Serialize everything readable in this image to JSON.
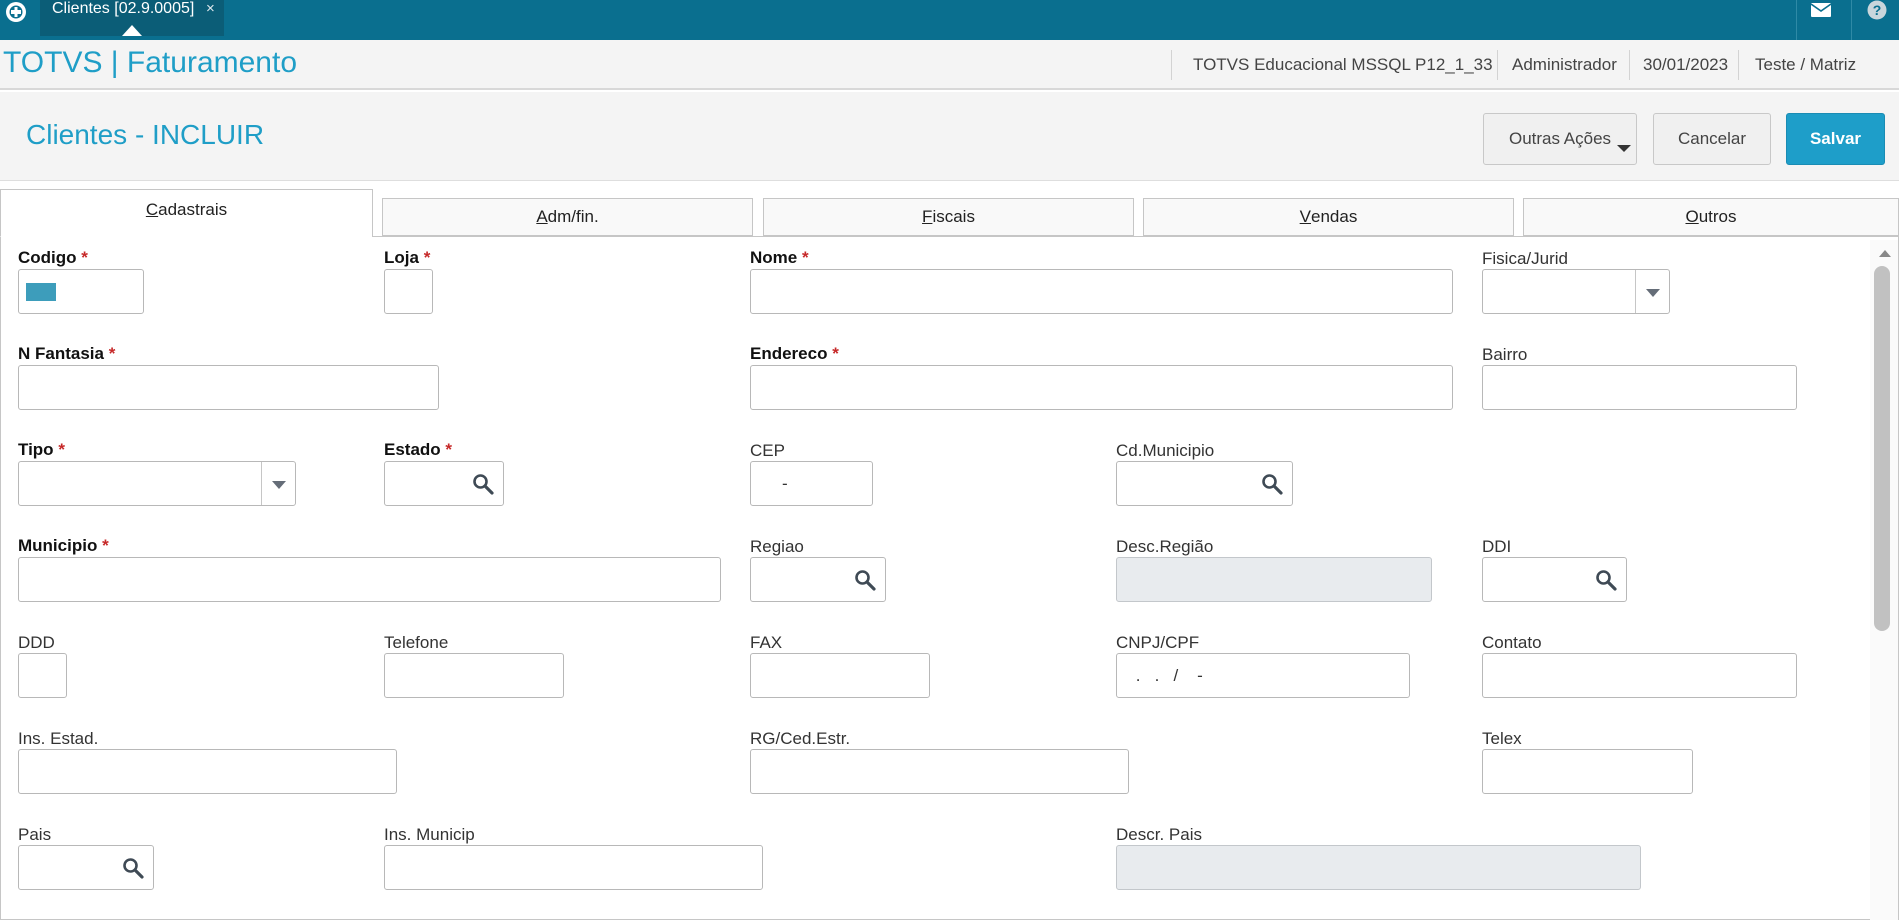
{
  "topbar": {
    "doc_tab_label": "Clientes [02.9.0005]",
    "close_glyph": "×",
    "icons": [
      "totvs-logo-icon",
      "mail-icon",
      "help-icon"
    ]
  },
  "header": {
    "module_title": "TOTVS | Faturamento",
    "environment": "TOTVS Educacional MSSQL P12_1_33",
    "user": "Administrador",
    "date": "30/01/2023",
    "branch": "Teste / Matriz"
  },
  "page": {
    "title": "Clientes - INCLUIR",
    "actions": {
      "other": "Outras Ações",
      "cancel": "Cancelar",
      "save": "Salvar"
    }
  },
  "tabs": [
    {
      "mnemonic": "C",
      "rest": "adastrais",
      "active": true
    },
    {
      "mnemonic": "A",
      "rest": "dm/fin.",
      "active": false
    },
    {
      "mnemonic": "F",
      "rest": "iscais",
      "active": false
    },
    {
      "mnemonic": "V",
      "rest": "endas",
      "active": false
    },
    {
      "mnemonic": "O",
      "rest": "utros",
      "active": false
    }
  ],
  "fields": {
    "codigo": {
      "label": "Codigo",
      "required": true,
      "value": ""
    },
    "loja": {
      "label": "Loja",
      "required": true,
      "value": ""
    },
    "nome": {
      "label": "Nome",
      "required": true,
      "value": ""
    },
    "fisica_jurid": {
      "label": "Fisica/Jurid",
      "required": false,
      "value": ""
    },
    "n_fantasia": {
      "label": "N Fantasia",
      "required": true,
      "value": ""
    },
    "endereco": {
      "label": "Endereco",
      "required": true,
      "value": ""
    },
    "bairro": {
      "label": "Bairro",
      "required": false,
      "value": ""
    },
    "tipo": {
      "label": "Tipo",
      "required": true,
      "value": ""
    },
    "estado": {
      "label": "Estado",
      "required": true,
      "value": ""
    },
    "cep": {
      "label": "CEP",
      "required": false,
      "mask": "-"
    },
    "cd_municipio": {
      "label": "Cd.Municipio",
      "required": false,
      "value": ""
    },
    "municipio": {
      "label": "Municipio",
      "required": true,
      "value": ""
    },
    "regiao": {
      "label": "Regiao",
      "required": false,
      "value": ""
    },
    "desc_regiao": {
      "label": "Desc.Região",
      "required": false,
      "value": ""
    },
    "ddi": {
      "label": "DDI",
      "required": false,
      "value": ""
    },
    "ddd": {
      "label": "DDD",
      "required": false,
      "value": ""
    },
    "telefone": {
      "label": "Telefone",
      "required": false,
      "value": ""
    },
    "fax": {
      "label": "FAX",
      "required": false,
      "value": ""
    },
    "cnpj_cpf": {
      "label": "CNPJ/CPF",
      "required": false,
      "mask": " .   .   /    -"
    },
    "contato": {
      "label": "Contato",
      "required": false,
      "value": ""
    },
    "ins_estad": {
      "label": "Ins. Estad.",
      "required": false,
      "value": ""
    },
    "rg_ced_estr": {
      "label": "RG/Ced.Estr.",
      "required": false,
      "value": ""
    },
    "telex": {
      "label": "Telex",
      "required": false,
      "value": ""
    },
    "pais": {
      "label": "Pais",
      "required": false,
      "value": ""
    },
    "ins_municip": {
      "label": "Ins. Municip",
      "required": false,
      "value": ""
    },
    "descr_pais": {
      "label": "Descr. Pais",
      "required": false,
      "value": ""
    }
  },
  "required_marker": "*",
  "colors": {
    "topbar": "#0a6f8f",
    "accent": "#1f9ec7",
    "primary_button": "#1e9ec9",
    "required_star": "#c62828",
    "disabled_field": "#e8ebee"
  }
}
